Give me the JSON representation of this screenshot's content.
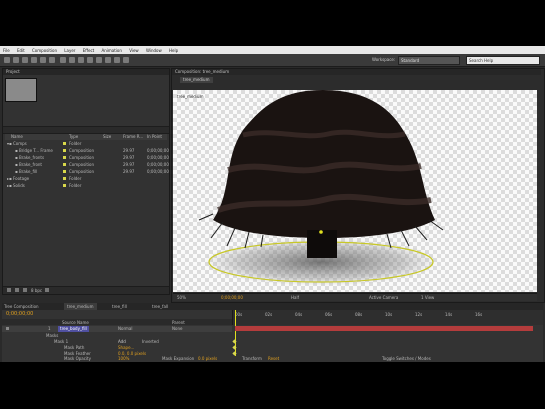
{
  "menubar": [
    "File",
    "Edit",
    "Composition",
    "Layer",
    "Effect",
    "Animation",
    "View",
    "Window",
    "Help"
  ],
  "toolbar": {
    "workspace_label": "Workspace:",
    "workspace_value": "Standard",
    "search_placeholder": "Search Help"
  },
  "project": {
    "tab": "Project",
    "columns": [
      "Name",
      "Type",
      "Size",
      "Frame R...",
      "In Point"
    ],
    "items": [
      {
        "name": "Comps",
        "type": "Folder",
        "size": "",
        "fps": "",
        "in": ""
      },
      {
        "name": "Bridge T... Frame",
        "type": "Composition",
        "size": "",
        "fps": "29.97",
        "in": "0;00;00;00"
      },
      {
        "name": "Brake_fronts",
        "type": "Composition",
        "size": "",
        "fps": "29.97",
        "in": "0;00;00;00"
      },
      {
        "name": "Brake_front",
        "type": "Composition",
        "size": "",
        "fps": "29.97",
        "in": "0;00;00;00"
      },
      {
        "name": "Brake_fill",
        "type": "Composition",
        "size": "",
        "fps": "29.97",
        "in": "0;00;00;00"
      },
      {
        "name": "Footage",
        "type": "Folder",
        "size": "",
        "fps": "",
        "in": ""
      },
      {
        "name": "Solids",
        "type": "Folder",
        "size": "",
        "fps": "",
        "in": ""
      }
    ],
    "bpc": "8 bpc"
  },
  "viewer": {
    "tab": "Composition: tree_medium",
    "subtab": "tree_medium",
    "comp_label": "tree_medium",
    "zoom": "50%",
    "timecode": "0;00;00;00",
    "resolution": "Half",
    "camera": "Active Camera",
    "views": "1 View"
  },
  "timeline": {
    "tabs": [
      "Tree Composition",
      "tree_medium",
      "tree_fill",
      "tree_fall"
    ],
    "timecode": "0;00;00;00",
    "ruler": [
      "00s",
      "02s",
      "04s",
      "06s",
      "08s",
      "10s",
      "12s",
      "14s",
      "16s"
    ],
    "layer": {
      "num": "1",
      "name": "tree_body_fill",
      "mode": "Normal"
    },
    "column_header": "Source Name",
    "parent_label": "Parent",
    "parent_value": "None",
    "props": [
      {
        "name": "Masks",
        "value": ""
      },
      {
        "name": "Mask 1",
        "value": "Add",
        "extra": "Inverted"
      },
      {
        "name": "Mask Path",
        "value": "Shape..."
      },
      {
        "name": "Mask Feather",
        "value": "0.0, 0.0 pixels"
      },
      {
        "name": "Mask Opacity",
        "value": "100%"
      },
      {
        "name": "Mask Expansion",
        "value": "0.0 pixels"
      },
      {
        "name": "Transform",
        "value": "Reset"
      }
    ],
    "footer": "Toggle Switches / Modes"
  }
}
